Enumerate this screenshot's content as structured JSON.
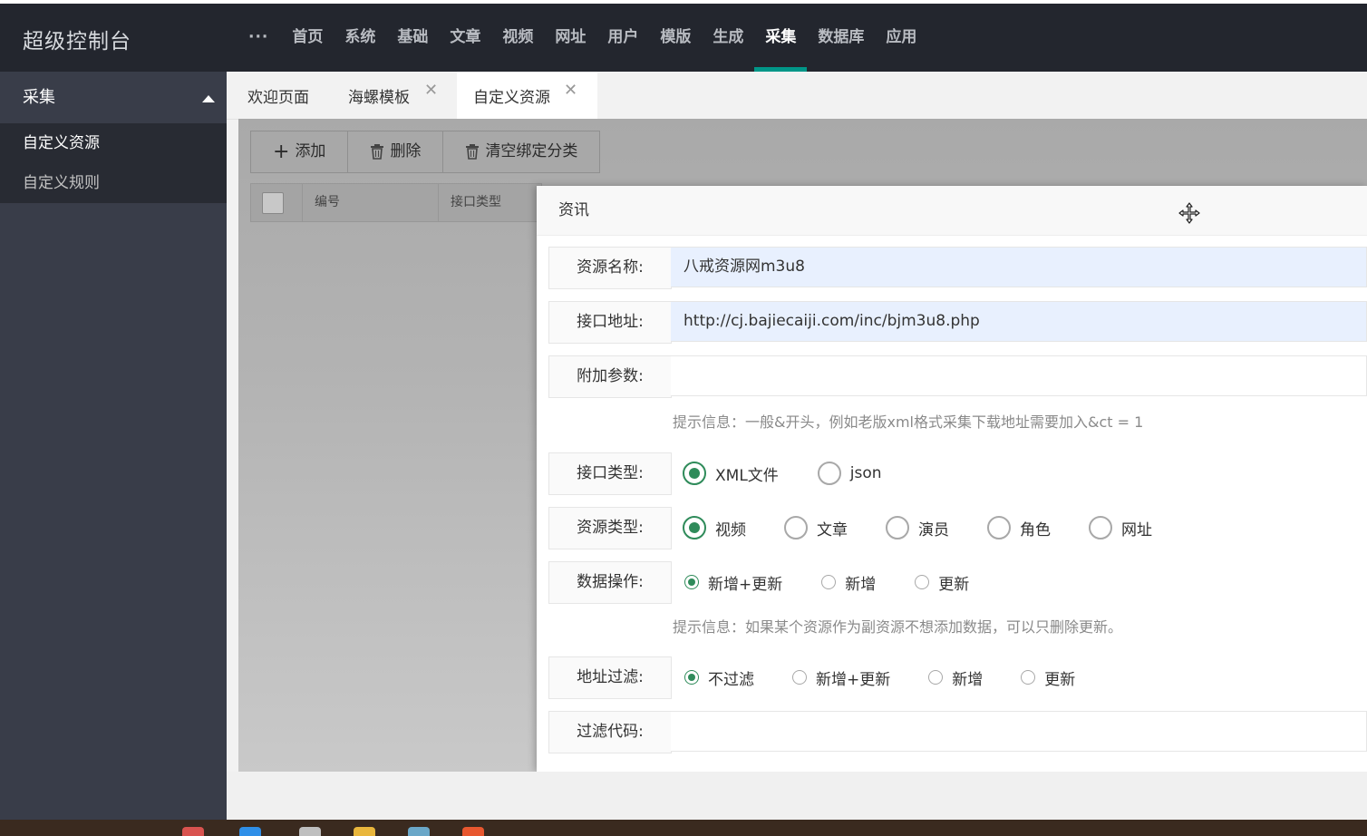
{
  "header": {
    "brand": "超级控制台",
    "more": "···",
    "nav": [
      "首页",
      "系统",
      "基础",
      "文章",
      "视频",
      "网址",
      "用户",
      "模版",
      "生成",
      "采集",
      "数据库",
      "应用"
    ],
    "active_index": 9
  },
  "sidebar": {
    "group": "采集",
    "items": [
      "自定义资源",
      "自定义规则"
    ]
  },
  "tabs": [
    {
      "label": "欢迎页面",
      "closable": false
    },
    {
      "label": "海螺模板",
      "closable": true
    },
    {
      "label": "自定义资源",
      "closable": true,
      "active": true
    }
  ],
  "toolbar": {
    "add": "添加",
    "delete": "删除",
    "clear": "清空绑定分类"
  },
  "table": {
    "headers": [
      "编号",
      "接口类型"
    ]
  },
  "dialog": {
    "title": "资讯",
    "resource_name": {
      "label": "资源名称:",
      "value": "八戒资源网m3u8"
    },
    "api_url": {
      "label": "接口地址:",
      "value": "http://cj.bajiecaiji.com/inc/bjm3u8.php"
    },
    "extra_params": {
      "label": "附加参数:",
      "value": ""
    },
    "extra_hint": "提示信息：一般&开头，例如老版xml格式采集下载地址需要加入&ct = 1",
    "api_type": {
      "label": "接口类型:",
      "options": [
        "XML文件",
        "json"
      ],
      "selected": 0
    },
    "res_type": {
      "label": "资源类型:",
      "options": [
        "视频",
        "文章",
        "演员",
        "角色",
        "网址"
      ],
      "selected": 0
    },
    "data_op": {
      "label": "数据操作:",
      "options": [
        "新增+更新",
        "新增",
        "更新"
      ],
      "selected": 0
    },
    "data_hint": "提示信息：如果某个资源作为副资源不想添加数据，可以只删除更新。",
    "url_filter": {
      "label": "地址过滤:",
      "options": [
        "不过滤",
        "新增+更新",
        "新增",
        "更新"
      ],
      "selected": 0
    },
    "filter_code": {
      "label": "过滤代码:",
      "value": ""
    }
  },
  "colors": {
    "accent": "#009688",
    "radio_checked": "#2f8b5a",
    "topbar": "#23262e",
    "sidebar": "#393d49"
  }
}
